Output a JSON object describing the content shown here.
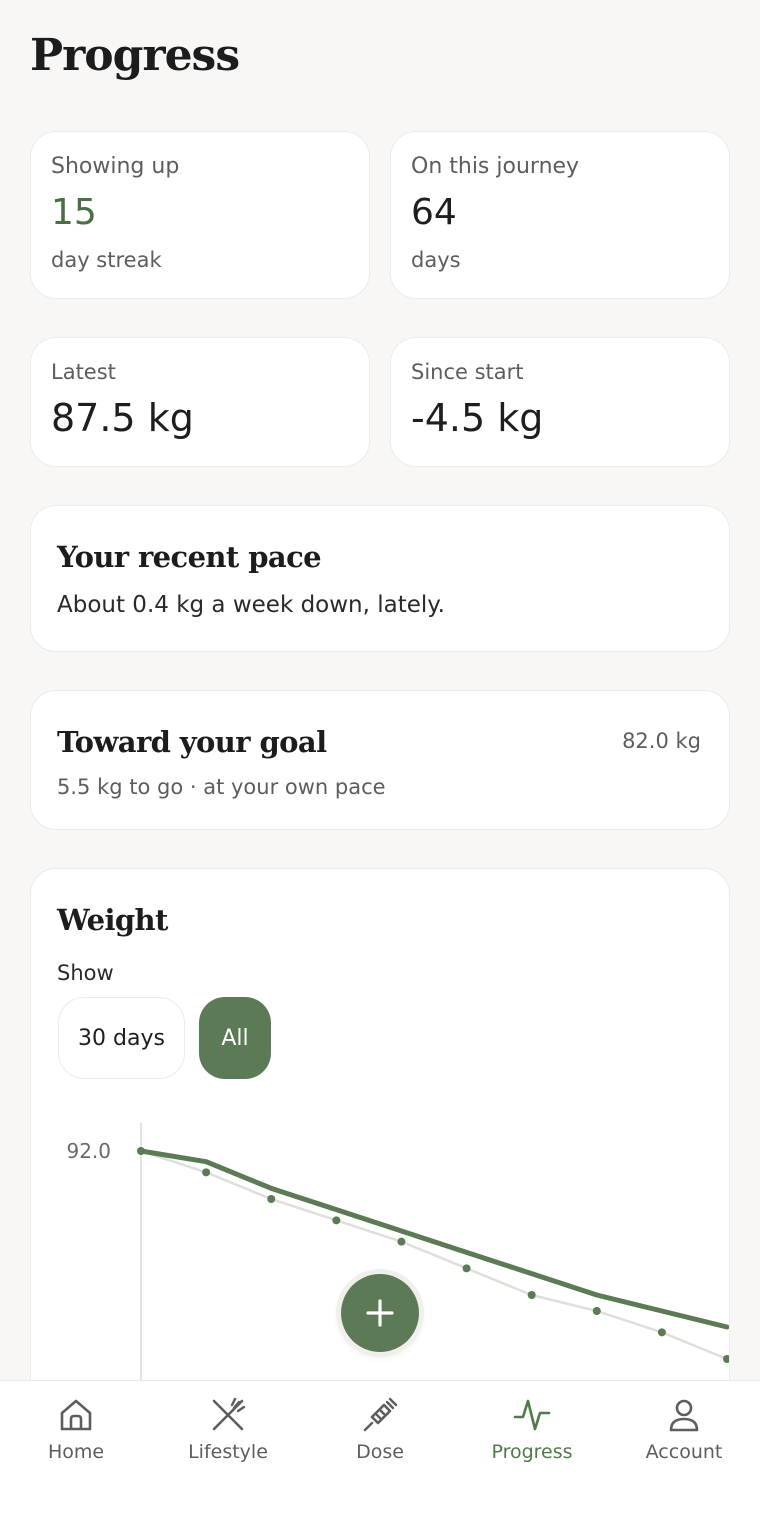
{
  "page": {
    "title": "Progress"
  },
  "stats": {
    "streak": {
      "label": "Showing up",
      "value": "15",
      "sub": "day streak"
    },
    "journey": {
      "label": "On this journey",
      "value": "64",
      "sub": "days"
    },
    "latest": {
      "label": "Latest",
      "value": "87.5 kg"
    },
    "since_start": {
      "label": "Since start",
      "value": "-4.5 kg"
    }
  },
  "pace": {
    "title": "Your recent pace",
    "text": "About 0.4 kg a week down, lately."
  },
  "goal": {
    "title": "Toward your goal",
    "target": "82.0 kg",
    "text": "5.5 kg to go · at your own pace"
  },
  "weight": {
    "title": "Weight",
    "show_label": "Show",
    "ranges": [
      {
        "label": "30 days",
        "active": false
      },
      {
        "label": "All",
        "active": true
      }
    ]
  },
  "chart_data": {
    "type": "line",
    "title": "Weight",
    "y_tick_labels": [
      "92.0"
    ],
    "series": [
      {
        "values": [
          92.0,
          91.6,
          91.1,
          90.7,
          90.3,
          89.8,
          89.3,
          89.0,
          88.6,
          88.1
        ]
      },
      {
        "values": [
          92.0,
          91.8,
          91.3,
          90.9,
          90.5,
          90.1,
          89.7,
          89.3,
          89.0,
          88.7
        ]
      }
    ],
    "ylim": [
      87.5,
      92.0
    ],
    "colors": {
      "points": "#5b7a55",
      "trend": "#5b7a55",
      "raw_line": "#e0dfd9"
    }
  },
  "fab": {
    "icon": "plus-icon"
  },
  "nav": {
    "items": [
      {
        "label": "Home",
        "icon": "home-icon",
        "active": false
      },
      {
        "label": "Lifestyle",
        "icon": "utensils-icon",
        "active": false
      },
      {
        "label": "Dose",
        "icon": "syringe-icon",
        "active": false
      },
      {
        "label": "Progress",
        "icon": "activity-icon",
        "active": true
      },
      {
        "label": "Account",
        "icon": "user-icon",
        "active": false
      }
    ]
  },
  "colors": {
    "accent": "#5b7a55",
    "background": "#f8f7f5",
    "card": "#ffffff"
  }
}
